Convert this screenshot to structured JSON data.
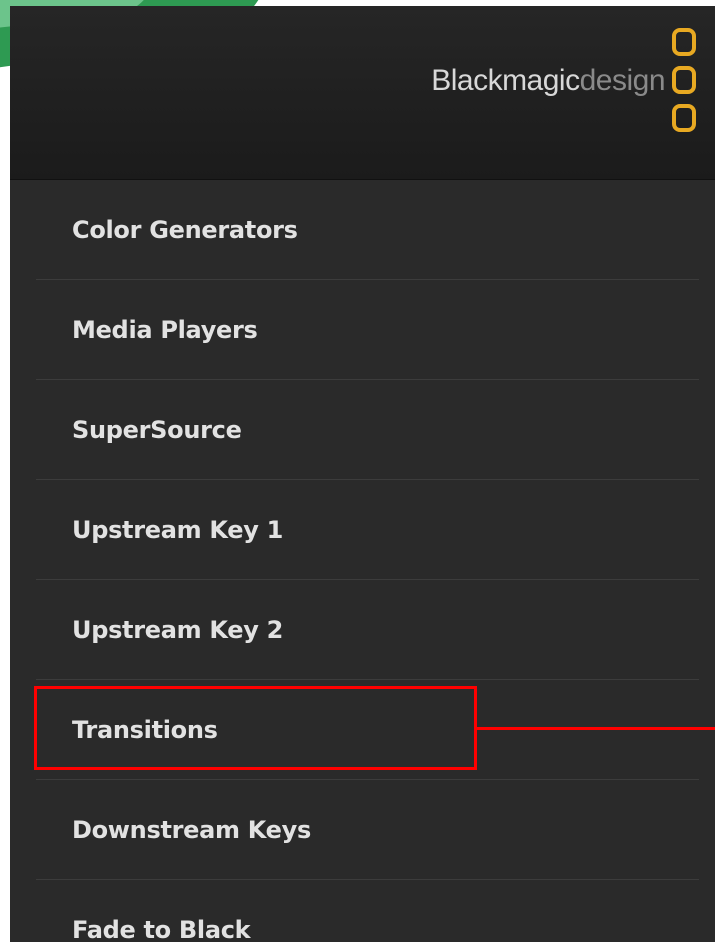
{
  "brand": {
    "name_main": "Blackmagic",
    "name_sub": "design"
  },
  "menu": {
    "items": [
      {
        "label": "Color Generators"
      },
      {
        "label": "Media Players"
      },
      {
        "label": "SuperSource"
      },
      {
        "label": "Upstream Key 1"
      },
      {
        "label": "Upstream Key 2"
      },
      {
        "label": "Transitions",
        "highlighted": true
      },
      {
        "label": "Downstream Keys"
      },
      {
        "label": "Fade to Black"
      }
    ]
  },
  "colors": {
    "panel_bg": "#2a2a2a",
    "header_bg": "#1f1f1f",
    "logo_accent": "#e8a922",
    "highlight": "#ff0000",
    "corner_green": "#2e9a52"
  },
  "icons": {
    "logo": "blackmagic-logo-icon"
  }
}
